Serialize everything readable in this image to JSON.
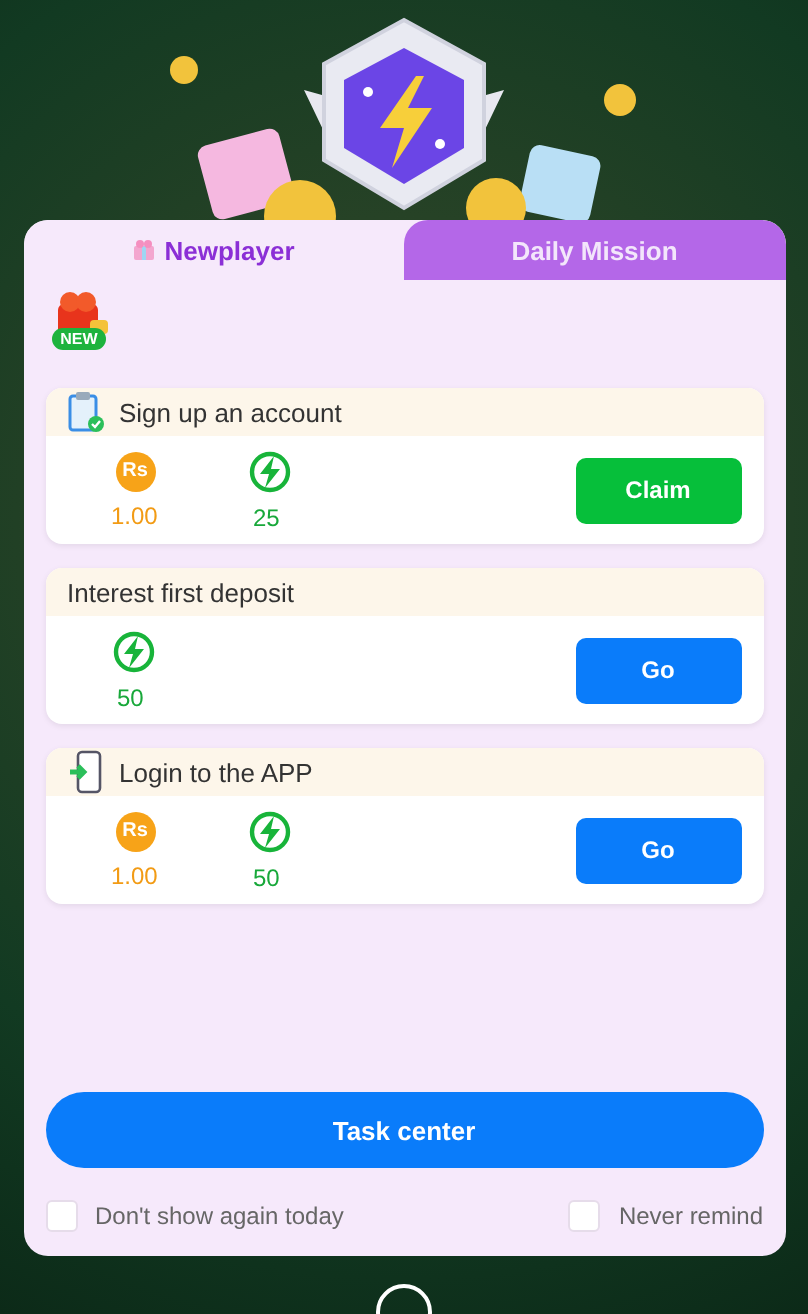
{
  "tabs": [
    {
      "label": "Newplayer",
      "selected": true
    },
    {
      "label": "Daily Mission",
      "selected": false
    }
  ],
  "new_badge": "NEW",
  "tasks": [
    {
      "kind": "signup",
      "title": "Sign up an account",
      "rewards": [
        {
          "kind": "cash",
          "symbol": "Rs",
          "amount": "1.00"
        },
        {
          "kind": "energy",
          "amount": "25"
        }
      ],
      "button": {
        "label": "Claim",
        "kind": "claim"
      }
    },
    {
      "title": "Interest first deposit",
      "rewards": [
        {
          "kind": "energy",
          "amount": "50"
        }
      ],
      "button": {
        "label": "Go",
        "kind": "go"
      }
    },
    {
      "kind": "login",
      "title": "Login to the APP",
      "rewards": [
        {
          "kind": "cash",
          "symbol": "Rs",
          "amount": "1.00"
        },
        {
          "kind": "energy",
          "amount": "50"
        }
      ],
      "button": {
        "label": "Go",
        "kind": "go"
      }
    }
  ],
  "task_center_button": "Task center",
  "options": [
    {
      "label": "Don't show again today",
      "checked": false
    },
    {
      "label": "Never remind",
      "checked": false
    }
  ]
}
